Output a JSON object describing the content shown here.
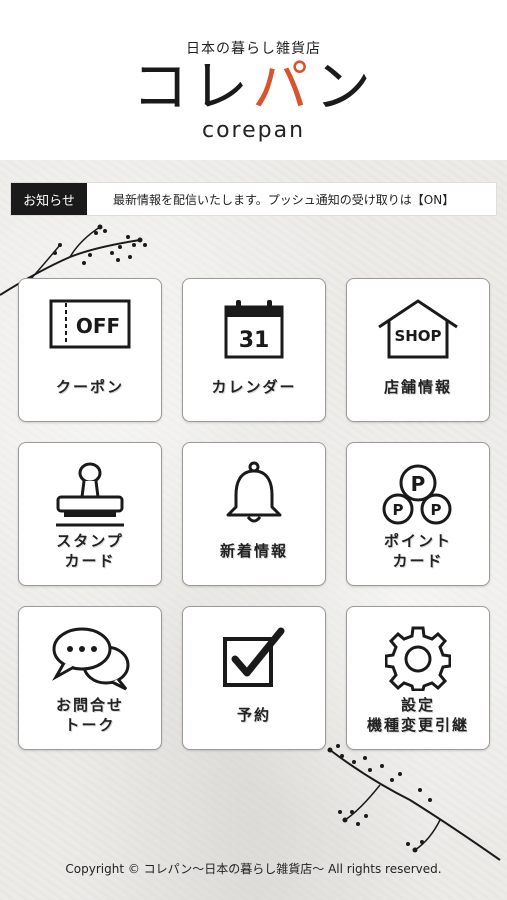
{
  "header": {
    "tagline": "日本の暮らし雑貨店",
    "logo_part1": "コレ",
    "logo_accent": "パ",
    "logo_part2": "ン",
    "logo_en": "corepan",
    "accent_color": "#d9532c"
  },
  "news": {
    "label": "お知らせ",
    "text": "最新情報を配信いたします。プッシュ通知の受け取りは【ON】"
  },
  "menu": [
    {
      "label": "クーポン",
      "icon": "coupon-off-icon",
      "icon_text": "OFF"
    },
    {
      "label": "カレンダー",
      "icon": "calendar-icon",
      "icon_text": "31"
    },
    {
      "label": "店舗情報",
      "icon": "shop-icon",
      "icon_text": "SHOP"
    },
    {
      "label": "スタンプ\nカード",
      "icon": "stamp-icon"
    },
    {
      "label": "新着情報",
      "icon": "bell-icon"
    },
    {
      "label": "ポイント\nカード",
      "icon": "point-coins-icon",
      "icon_text": "P"
    },
    {
      "label": "お問合せ\nトーク",
      "icon": "chat-bubbles-icon"
    },
    {
      "label": "予約",
      "icon": "checkbox-icon"
    },
    {
      "label": "設定\n機種変更引継",
      "icon": "gear-icon"
    }
  ],
  "footer": {
    "copyright": "Copyright © コレパン〜日本の暮らし雑貨店〜 All rights reserved."
  }
}
